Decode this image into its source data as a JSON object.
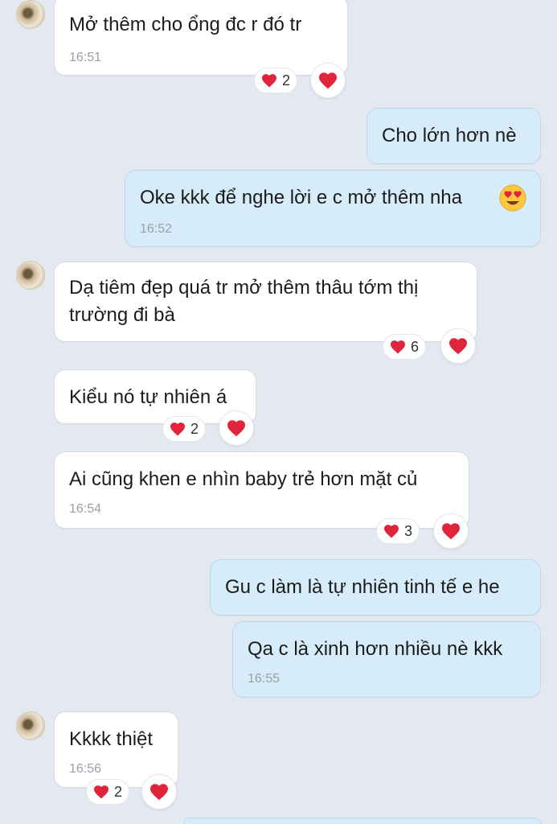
{
  "colors": {
    "background": "#e4e8f0",
    "incoming": "#ffffff",
    "outgoing": "#d6ecf9",
    "heart": "#e0243b"
  },
  "messages": [
    {
      "text": "Mở thêm cho ổng đc r đó tr",
      "time": "16:51",
      "reaction_count": "2"
    },
    {
      "text": "Cho lớn hơn nè"
    },
    {
      "text": "Oke kkk để nghe lời e c mở thêm nha",
      "emoji": "heart-eyes-emoji",
      "time": "16:52"
    },
    {
      "line1": "Dạ tiêm đẹp quá tr mở thêm thâu tớm thị",
      "line2": "trường đi bà",
      "reaction_count": "6"
    },
    {
      "text": "Kiểu nó tự nhiên á",
      "reaction_count": "2"
    },
    {
      "text": "Ai cũng khen e nhìn baby trẻ hơn mặt củ",
      "time": "16:54",
      "reaction_count": "3"
    },
    {
      "text": "Gu c làm là tự nhiên tinh tế e he"
    },
    {
      "text": "Qa c là xinh hơn nhiều nè kkk",
      "time": "16:55"
    },
    {
      "text": "Kkkk thiệt",
      "time": "16:56",
      "reaction_count": "2"
    }
  ]
}
